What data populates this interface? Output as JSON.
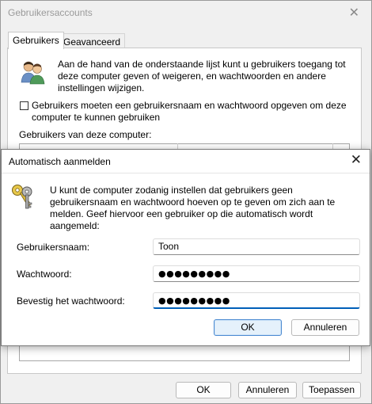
{
  "bg_window": {
    "title": "Gebruikersaccounts",
    "tabs": [
      {
        "label": "Gebruikers"
      },
      {
        "label": "Geavanceerd"
      }
    ],
    "intro_text": "Aan de hand van de onderstaande lijst kunt u gebruikers toegang tot deze computer geven of weigeren, en wachtwoorden en andere instellingen wijzigen.",
    "require_login_checkbox_label": "Gebruikers moeten een gebruikersnaam en wachtwoord opgeven om deze computer te kunnen gebruiken",
    "require_login_checked": false,
    "users_list_label": "Gebruikers van deze computer:",
    "buttons": {
      "ok": "OK",
      "cancel": "Annuleren",
      "apply": "Toepassen"
    }
  },
  "dialog": {
    "title": "Automatisch aanmelden",
    "description": "U kunt de computer zodanig instellen dat gebruikers geen gebruikersnaam en wachtwoord hoeven op te geven om zich aan te melden. Geef hiervoor een gebruiker op die automatisch wordt aangemeld:",
    "username_label": "Gebruikersnaam:",
    "username_value": "Toon",
    "password_label": "Wachtwoord:",
    "password_value": "●●●●●●●●●",
    "confirm_label": "Bevestig het wachtwoord:",
    "confirm_value": "●●●●●●●●●",
    "ok_label": "OK",
    "cancel_label": "Annuleren"
  },
  "colors": {
    "accent": "#005fb8",
    "primary_button_border": "#4b8ad1",
    "primary_button_fill": "#e5f1fb"
  },
  "icons": {
    "bg_close": "close-icon",
    "dialog_close": "close-icon",
    "users": "users-icon",
    "keys": "keys-icon"
  }
}
